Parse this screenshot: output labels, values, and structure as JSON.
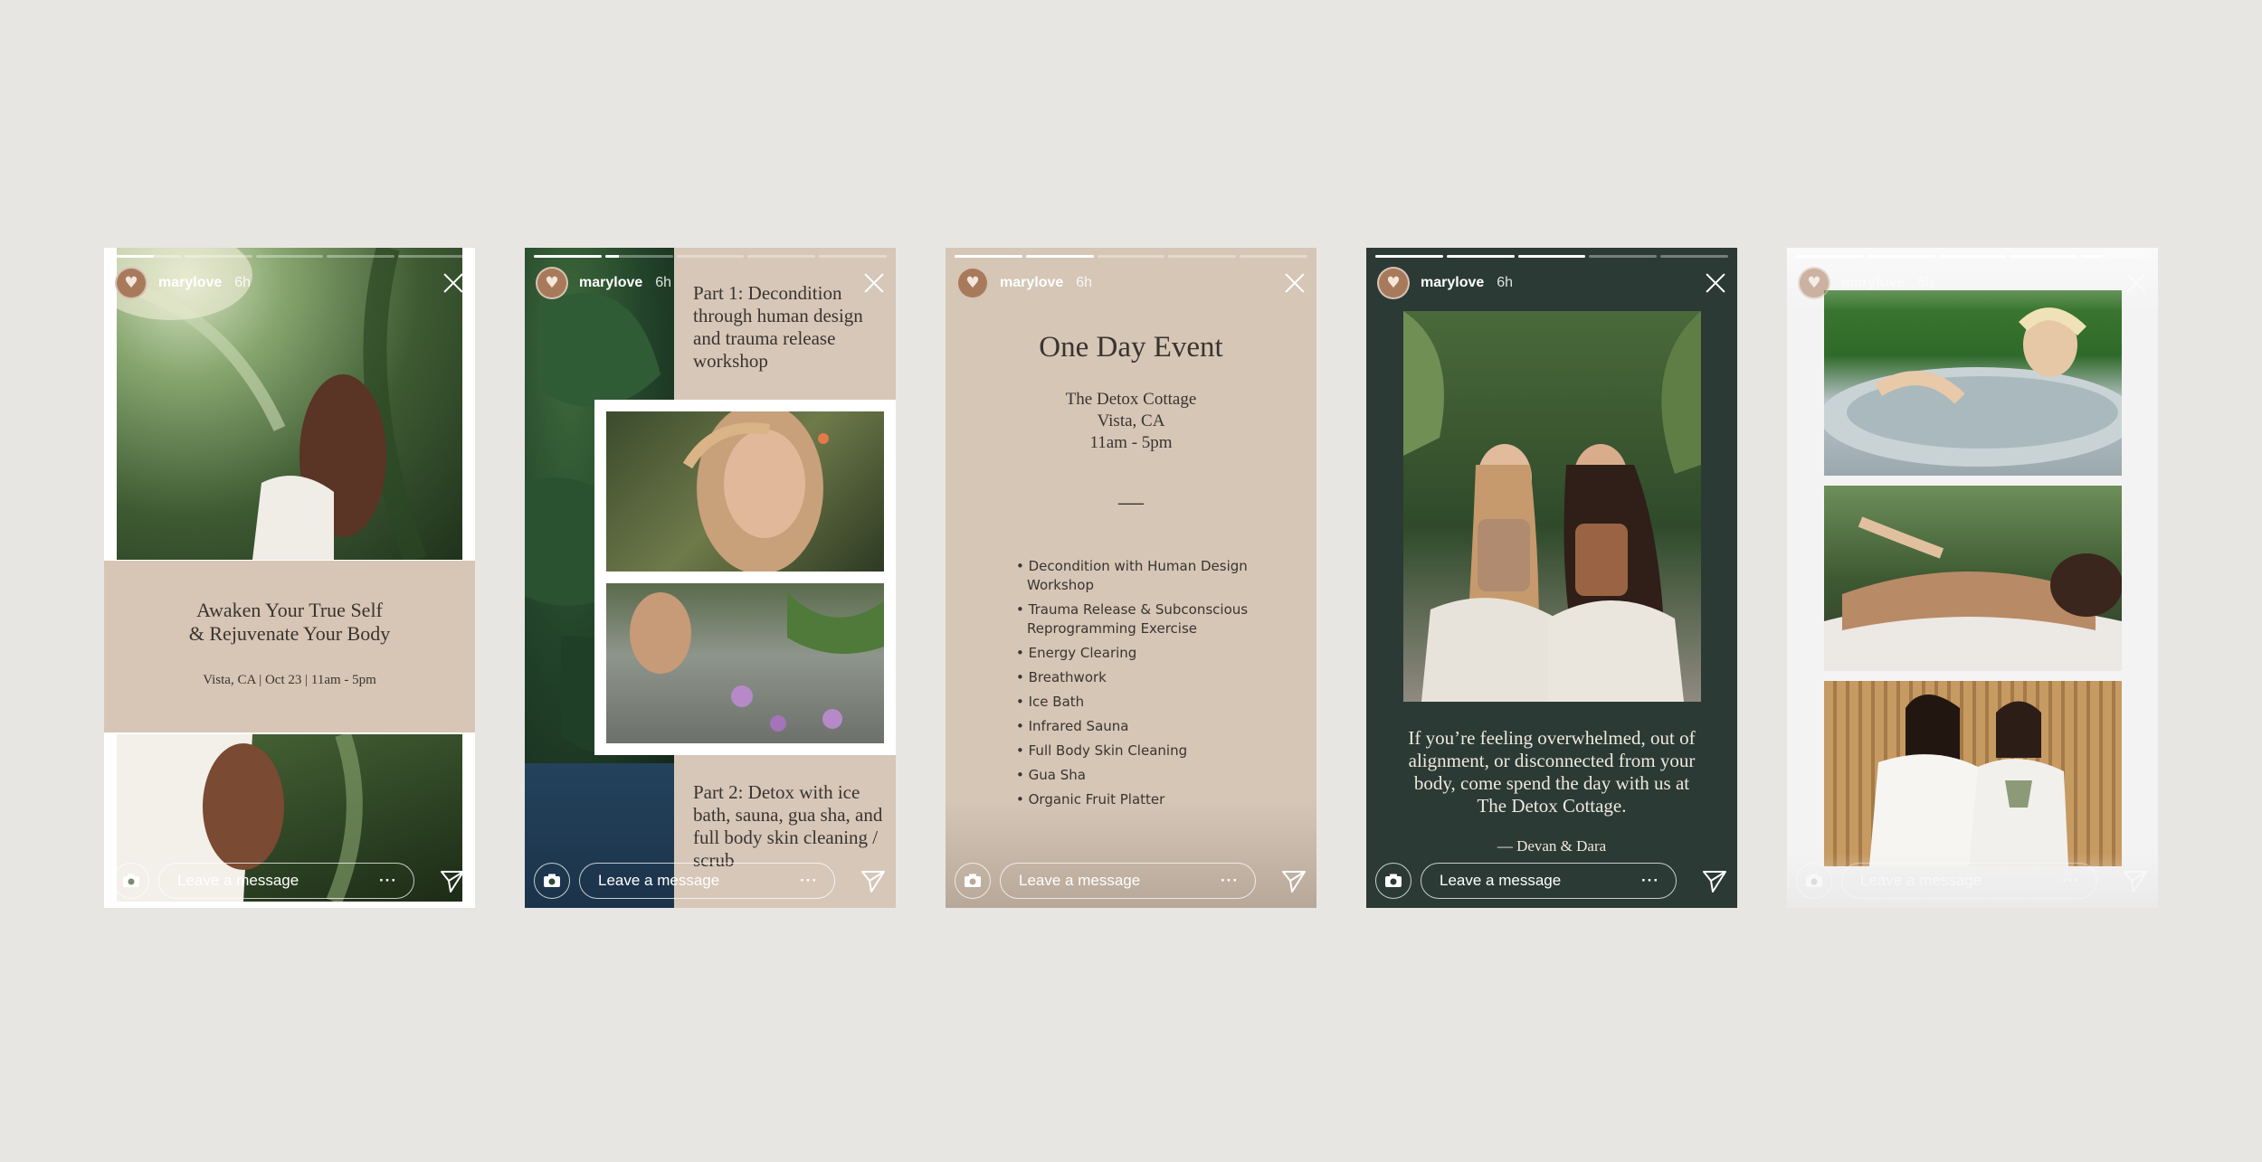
{
  "user": {
    "name": "marylove",
    "time": "6h",
    "avatar_glyph": "♥"
  },
  "footer": {
    "placeholder": "Leave a message",
    "dots": "···"
  },
  "colors": {
    "page_bg": "#e8e6e3",
    "beige": "#d6c7b8",
    "forest": "#2b3a35",
    "avatar": "#a87a5c"
  },
  "stories": [
    {
      "progress": [
        0.6,
        0,
        0,
        0,
        0
      ],
      "headline_line1": "Awaken Your True Self",
      "headline_line2": "& Rejuvenate Your Body",
      "details": "Vista, CA | Oct 23 | 11am - 5pm"
    },
    {
      "progress": [
        1,
        0.2,
        0,
        0,
        0
      ],
      "part1": "Part 1: Decondition through human design and trauma release workshop",
      "part2": "Part 2: Detox with ice bath, sauna, gua sha, and full body skin cleaning / scrub"
    },
    {
      "progress": [
        1,
        1,
        0,
        0,
        0
      ],
      "title": "One Day Event",
      "venue": "The Detox Cottage",
      "location": "Vista, CA",
      "hours": "11am - 5pm",
      "divider": "—",
      "items": [
        "Decondition with Human Design Workshop",
        "Trauma Release & Subconscious Reprogramming Exercise",
        "Energy Clearing",
        "Breathwork",
        "Ice Bath",
        "Infrared Sauna",
        "Full Body Skin Cleaning",
        "Gua Sha",
        "Organic Fruit Platter"
      ]
    },
    {
      "progress": [
        1,
        1,
        1,
        0,
        0
      ],
      "quote": "If you’re feeling overwhelmed, out of alignment, or disconnected from your body, come spend the day with us at The Detox Cottage.",
      "signature": "— Devan & Dara"
    },
    {
      "progress": [
        1,
        1,
        1,
        1,
        0.3
      ]
    }
  ]
}
